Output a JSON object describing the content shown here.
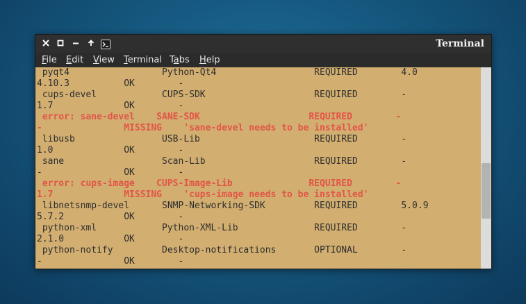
{
  "window": {
    "title": "Terminal"
  },
  "menu": [
    {
      "mnemonic": "F",
      "rest": "ile"
    },
    {
      "mnemonic": "E",
      "rest": "dit"
    },
    {
      "mnemonic": "V",
      "rest": "iew"
    },
    {
      "mnemonic": "T",
      "rest": "erminal"
    },
    {
      "mnemonic": "",
      "rest": "T",
      "after_mnemonic": "a",
      "tail": "bs"
    },
    {
      "mnemonic": "H",
      "rest": "elp"
    }
  ],
  "terminal_lines": [
    {
      "text": " pyqt4                 Python-Qt4                  REQUIRED        4.0",
      "error": false
    },
    {
      "text": "4.10.3          OK        -",
      "error": false
    },
    {
      "text": " cups-devel            CUPS-SDK                    REQUIRED        -",
      "error": false
    },
    {
      "text": "1.7             OK        -",
      "error": false
    },
    {
      "text": " error: sane-devel    SANE-SDK                    REQUIRED        -",
      "error": true
    },
    {
      "text": "-               MISSING    'sane-devel needs to be installed'",
      "error": true
    },
    {
      "text": " libusb                USB-Lib                     REQUIRED        -",
      "error": false
    },
    {
      "text": "1.0             OK        -",
      "error": false
    },
    {
      "text": " sane                  Scan-Lib                    REQUIRED        -",
      "error": false
    },
    {
      "text": "-               OK        -",
      "error": false
    },
    {
      "text": " error: cups-image    CUPS-Image-Lib              REQUIRED        -",
      "error": true
    },
    {
      "text": "1.7             MISSING    'cups-image needs to be installed'",
      "error": true
    },
    {
      "text": " libnetsnmp-devel      SNMP-Networking-SDK         REQUIRED        5.0.9",
      "error": false
    },
    {
      "text": "5.7.2           OK        -",
      "error": false
    },
    {
      "text": " python-xml            Python-XML-Lib              REQUIRED        -",
      "error": false
    },
    {
      "text": "2.1.0           OK        -",
      "error": false
    },
    {
      "text": " python-notify         Desktop-notifications       OPTIONAL        -",
      "error": false
    },
    {
      "text": "-               OK        -",
      "error": false
    }
  ],
  "colors": {
    "terminal_bg": "#d2ae70",
    "terminal_fg": "#2e2e2e",
    "error_fg": "#e25547"
  }
}
